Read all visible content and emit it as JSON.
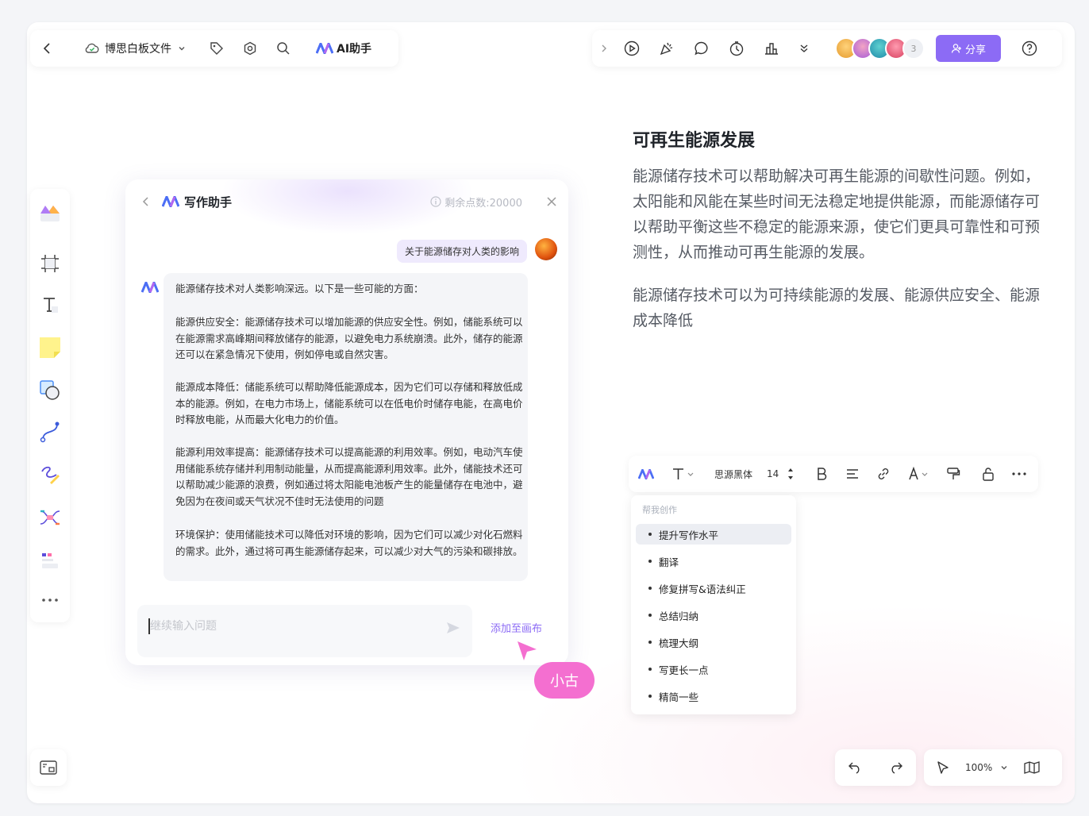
{
  "toolbar": {
    "file_name": "博思白板文件",
    "ai_label": "AI助手",
    "avatar_count": "3",
    "share_label": "分享"
  },
  "panel": {
    "title": "写作助手",
    "credits": "剩余点数:20000",
    "user_message": "关于能源储存对人类的影响",
    "response": [
      "能源储存技术对人类影响深远。以下是一些可能的方面：",
      "能源供应安全：能源储存技术可以增加能源的供应安全性。例如，储能系统可以在能源需求高峰期间释放储存的能源，以避免电力系统崩溃。此外，储存的能源还可以在紧急情况下使用，例如停电或自然灾害。",
      "能源成本降低：储能系统可以帮助降低能源成本，因为它们可以存储和释放低成本的能源。例如，在电力市场上，储能系统可以在低电价时储存电能，在高电价时释放电能，从而最大化电力的价值。",
      "能源利用效率提高：能源储存技术可以提高能源的利用效率。例如，电动汽车使用储能系统存储并利用制动能量，从而提高能源利用效率。此外，储能技术还可以帮助减少能源的浪费，例如通过将太阳能电池板产生的能量储存在电池中，避免因为在夜间或天气状况不佳时无法使用的问题",
      "环境保护：使用储能技术可以降低对环境的影响，因为它们可以减少对化石燃料的需求。此外，通过将可再生能源储存起来，可以减少对大气的污染和碳排放。"
    ],
    "input_placeholder": "继续输入问题",
    "add_to_canvas": "添加至画布"
  },
  "cursor_user": "小古",
  "document": {
    "title": "可再生能源发展",
    "paragraph1": "能源储存技术可以帮助解决可再生能源的间歇性问题。例如，太阳能和风能在某些时间无法稳定地提供能源，而能源储存可以帮助平衡这些不稳定的能源来源，使它们更具可靠性和可预测性，从而推动可再生能源的发展。",
    "paragraph2": "能源储存技术可以为可持续能源的发展、能源供应安全、能源成本降低"
  },
  "format_bar": {
    "font_name": "思源黑体",
    "font_size": "14"
  },
  "ai_menu": {
    "heading": "帮我创作",
    "items": [
      "提升写作水平",
      "翻译",
      "修复拼写&语法纠正",
      "总结归纳",
      "梳理大纲",
      "写更长一点",
      "精简一些"
    ],
    "active_index": 0
  },
  "zoom": "100%",
  "colors": {
    "accent": "#8c6bf5",
    "cursor_tag": "#f46fd0"
  }
}
